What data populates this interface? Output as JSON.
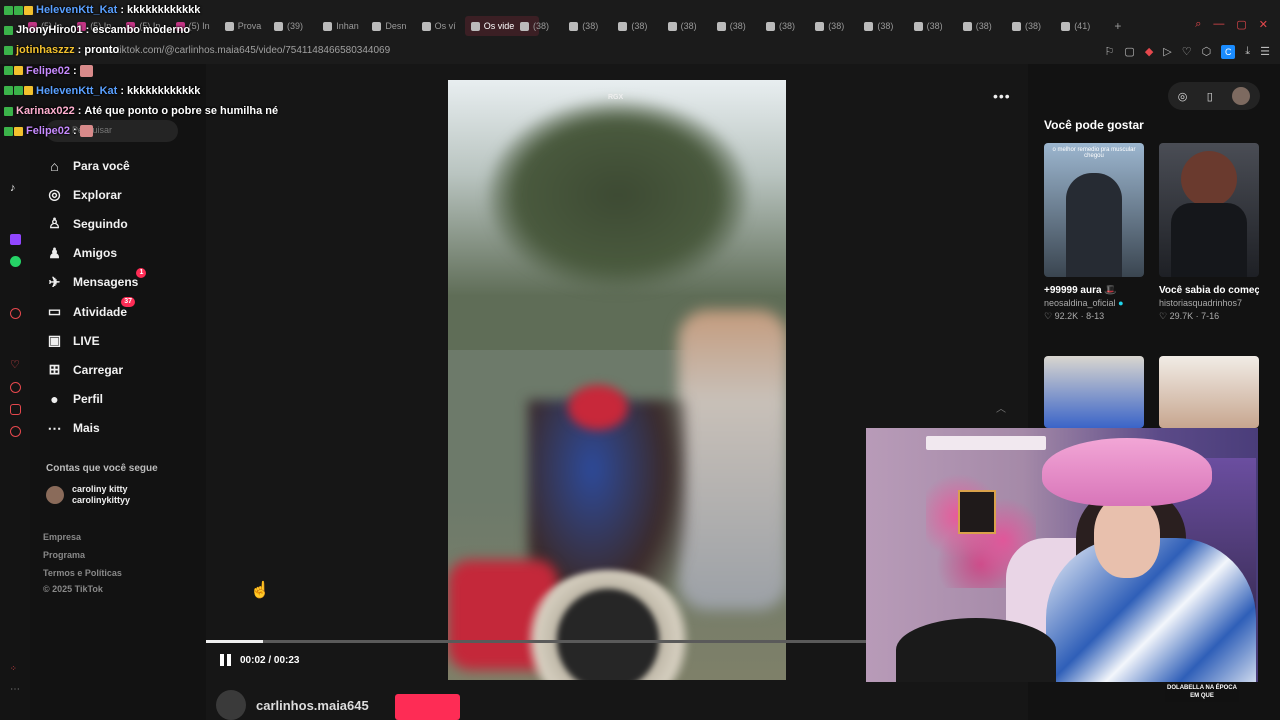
{
  "browser": {
    "tabs": [
      {
        "label": "(5) In",
        "kind": "ig"
      },
      {
        "label": "(5) In",
        "kind": "ig"
      },
      {
        "label": "(5) In",
        "kind": "ig"
      },
      {
        "label": "(5) In",
        "kind": "ig"
      },
      {
        "label": "Prova",
        "kind": "tt"
      },
      {
        "label": "(39)",
        "kind": "tt"
      },
      {
        "label": "Inhan",
        "kind": "tt"
      },
      {
        "label": "Desn",
        "kind": "tt"
      },
      {
        "label": "Os ví",
        "kind": "tt"
      },
      {
        "label": "Os vide",
        "kind": "tt",
        "active": true
      },
      {
        "label": "(38)",
        "kind": "tt"
      },
      {
        "label": "(38)",
        "kind": "tt"
      },
      {
        "label": "(38)",
        "kind": "tt"
      },
      {
        "label": "(38)",
        "kind": "tt"
      },
      {
        "label": "(38)",
        "kind": "tt"
      },
      {
        "label": "(38)",
        "kind": "tt"
      },
      {
        "label": "(38)",
        "kind": "tt"
      },
      {
        "label": "(38)",
        "kind": "tt"
      },
      {
        "label": "(38)",
        "kind": "tt"
      },
      {
        "label": "(38)",
        "kind": "tt"
      },
      {
        "label": "(38)",
        "kind": "tt"
      },
      {
        "label": "(41)",
        "kind": "tt"
      }
    ],
    "new_tab": "+",
    "url": "ww.tiktok.com/@carlinhos.maia645/video/7541148466580344069",
    "ext_badge": "C"
  },
  "sidebar": {
    "search_placeholder": "Pesquisar",
    "nav": [
      {
        "label": "Para você",
        "icon": "home-icon",
        "glyph": "⌂"
      },
      {
        "label": "Explorar",
        "icon": "compass-icon",
        "glyph": "◎"
      },
      {
        "label": "Seguindo",
        "icon": "following-icon",
        "glyph": "♙"
      },
      {
        "label": "Amigos",
        "icon": "friends-icon",
        "glyph": "♟"
      },
      {
        "label": "Mensagens",
        "icon": "messages-icon",
        "glyph": "✈",
        "count": "1"
      },
      {
        "label": "Atividade",
        "icon": "activity-icon",
        "glyph": "▭",
        "count": "37"
      },
      {
        "label": "LIVE",
        "icon": "live-icon",
        "glyph": "▣"
      },
      {
        "label": "Carregar",
        "icon": "upload-icon",
        "glyph": "⊞"
      },
      {
        "label": "Perfil",
        "icon": "profile-icon",
        "glyph": "●"
      },
      {
        "label": "Mais",
        "icon": "more-icon",
        "glyph": "⋯"
      }
    ],
    "following_heading": "Contas que você segue",
    "account": {
      "name": "caroliny kitty",
      "handle": "carolinykittyy"
    },
    "footer": [
      "Empresa",
      "Programa",
      "Termos e Políticas",
      "© 2025 TikTok"
    ]
  },
  "video": {
    "watermark": "RGX",
    "time": "00:02 / 00:23",
    "progress": 0.087,
    "author": "carlinhos.maia645"
  },
  "recommendations": {
    "title": "Você pode gostar",
    "cards": [
      {
        "caption": "+99999 aura 🎩",
        "author": "neosaldina_oficial",
        "verified": true,
        "likes": "92.2K",
        "age": "8-13",
        "thumb_text": "o melhor remedio pra muscular chegou"
      },
      {
        "caption": "Você sabia do começo do Mister...",
        "author": "historiasquadrinhos7",
        "likes": "29.7K",
        "age": "7-16"
      },
      {
        "caption": "",
        "author": "",
        "likes": "",
        "age": ""
      },
      {
        "caption": "",
        "author": "",
        "likes": "",
        "age": ""
      }
    ]
  },
  "stream_overlay": {
    "chat": [
      {
        "user": "HelevenKtt_Kat",
        "text": "kkkkkkkkkkkk",
        "color": "#5aa0ff",
        "badges": [
          "green",
          "green",
          "yellow"
        ]
      },
      {
        "user": "JhonyHiro01",
        "text": "escambo moderno",
        "color": "#ffffff",
        "badges": [
          "green"
        ]
      },
      {
        "user": "jotinhaszzz",
        "text": "pronto",
        "color": "#f2c12e",
        "badges": [
          "green"
        ]
      },
      {
        "user": "Felipe02",
        "text": "",
        "color": "#c78bff",
        "badges": [
          "green",
          "yellow"
        ],
        "emote": true
      },
      {
        "user": "HelevenKtt_Kat",
        "text": "kkkkkkkkkkkk",
        "color": "#5aa0ff",
        "badges": [
          "green",
          "green",
          "yellow"
        ]
      },
      {
        "user": "Karinax022",
        "text": "Até que ponto o pobre se humilha né",
        "color": "#ffb0d0",
        "badges": [
          "green"
        ]
      },
      {
        "user": "Felipe02",
        "text": "",
        "color": "#c78bff",
        "badges": [
          "green",
          "yellow"
        ],
        "emote": true
      }
    ],
    "webcam_caption": "DOLABELLA NA ÉPOCA EM QUE"
  },
  "colors": {
    "accent": "#fe2c55",
    "bg": "#121212"
  }
}
